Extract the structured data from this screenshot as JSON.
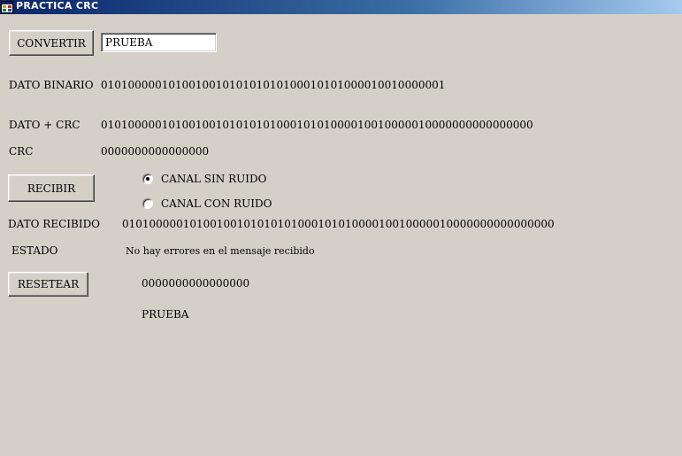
{
  "window": {
    "title": "PRACTICA CRC"
  },
  "convert": {
    "button_label": "CONVERTIR",
    "input_value": "PRUEBA"
  },
  "dato_binario": {
    "label": "DATO BINARIO",
    "value": "010100000101001001010101010100010101000010010000001"
  },
  "dato_crc": {
    "label": "DATO + CRC",
    "value": "0101000001010010010101010100010101000010010000010000000000000000"
  },
  "crc": {
    "label": "CRC",
    "value": "0000000000000000"
  },
  "recibir": {
    "button_label": "RECIBIR"
  },
  "channel": {
    "options": [
      {
        "label": "CANAL SIN RUIDO",
        "selected": true
      },
      {
        "label": "CANAL CON RUIDO",
        "selected": false
      }
    ]
  },
  "dato_recibido": {
    "label": "DATO RECIBIDO",
    "value": "0101000001010010010101010100010101000010010000010000000000000000"
  },
  "estado": {
    "label": "ESTADO",
    "value": "No hay errores en el mensaje recibido"
  },
  "resetear": {
    "button_label": "RESETEAR"
  },
  "result": {
    "crc_check": "0000000000000000",
    "decoded_text": "PRUEBA"
  }
}
